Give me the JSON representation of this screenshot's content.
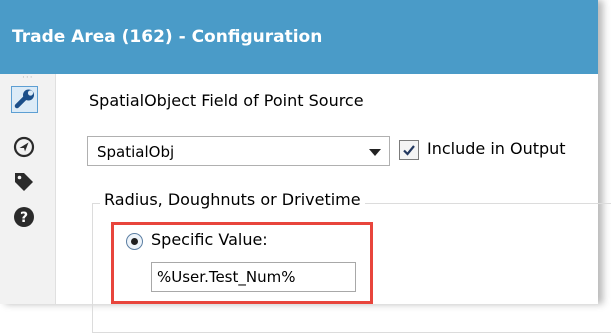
{
  "window": {
    "title": "Trade Area (162) - Configuration"
  },
  "toolbar": {
    "grip": "···",
    "icons": [
      "wrench-icon",
      "navigate-icon",
      "tag-icon",
      "help-icon"
    ],
    "selected": "wrench-icon"
  },
  "form": {
    "source_label": "SpatialObject Field of Point Source",
    "field_select_value": "SpatialObj",
    "include_checked": true,
    "include_label": "Include in Output",
    "radius_group_label": "Radius, Doughnuts or Drivetime",
    "specific_value_selected": true,
    "specific_value_label": "Specific Value:",
    "specific_value_input": "%User.Test_Num%"
  },
  "colors": {
    "title_bar": "#4a9bc8",
    "highlight": "#e8453c"
  }
}
